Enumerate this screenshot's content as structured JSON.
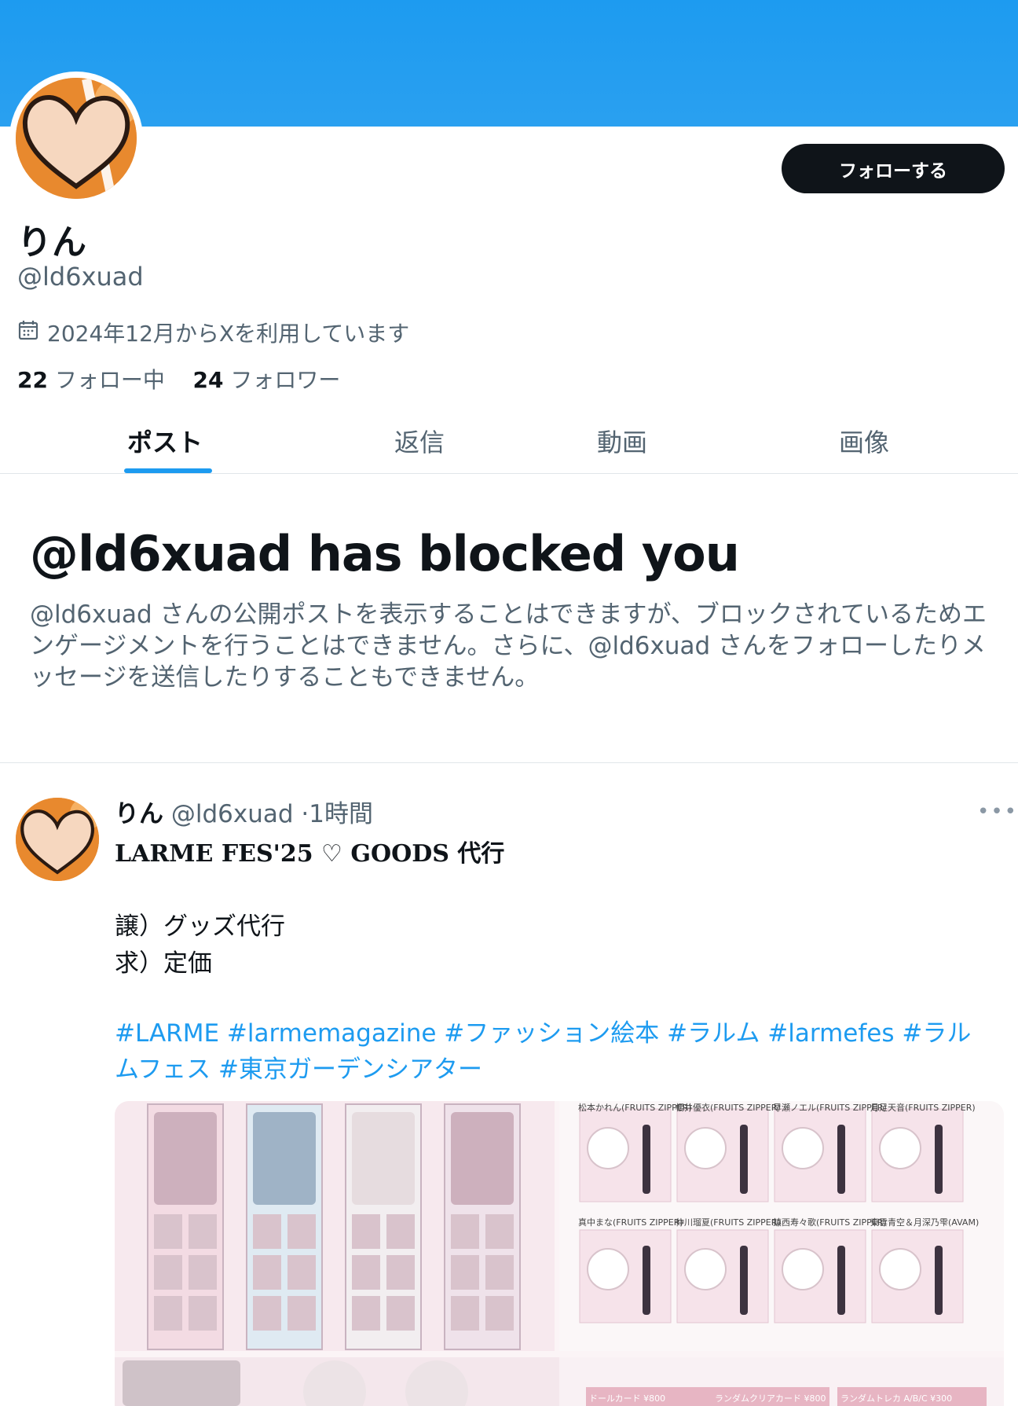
{
  "profile": {
    "name": "りん",
    "handle": "@ld6xuad",
    "joined": "2024年12月からXを利用しています",
    "following_count": "22",
    "following_label": "フォロー中",
    "followers_count": "24",
    "followers_label": "フォロワー",
    "follow_button": "フォローする"
  },
  "tabs": [
    {
      "label": "ポスト",
      "active": true
    },
    {
      "label": "返信",
      "active": false
    },
    {
      "label": "動画",
      "active": false
    },
    {
      "label": "画像",
      "active": false
    }
  ],
  "blocked": {
    "title": "@ld6xuad has blocked you",
    "text": "@ld6xuad さんの公開ポストを表示することはできますが、ブロックされているためエンゲージメントを行うことはできません。さらに、@ld6xuad さんをフォローしたりメッセージを送信したりすることもできません。"
  },
  "post": {
    "name": "りん",
    "handle": "@ld6xuad",
    "time": "1時間",
    "title": "LARME FES'25 ♡ GOODS 代行",
    "line1": "譲）グッズ代行",
    "line2": "求）定価",
    "hashtags": "#LARME #larmemagazine #ファッション絵本 #ラルム #larmefes #ラルムフェス #東京ガーデンシアター"
  },
  "media": {
    "acrylic_labels": [
      "松本かれん(FRUITS ZIPPER)",
      "櫻井優衣(FRUITS ZIPPER)",
      "早瀬ノエル(FRUITS ZIPPER)",
      "月足天音(FRUITS ZIPPER)",
      "真中まな(FRUITS ZIPPER)",
      "仲川瑠夏(FRUITS ZIPPER)",
      "鎮西寿々歌(FRUITS ZIPPER)",
      "東雲青空＆月深乃雫(AVAM)"
    ],
    "prices": [
      "ドールカード ¥800",
      "ランダムクリアカード ¥800",
      "ランダムトレカ A/B/C ¥300"
    ]
  },
  "colors": {
    "banner": "#1d9bf0",
    "accent": "#1d9bf0",
    "button_bg": "#0f1419"
  }
}
